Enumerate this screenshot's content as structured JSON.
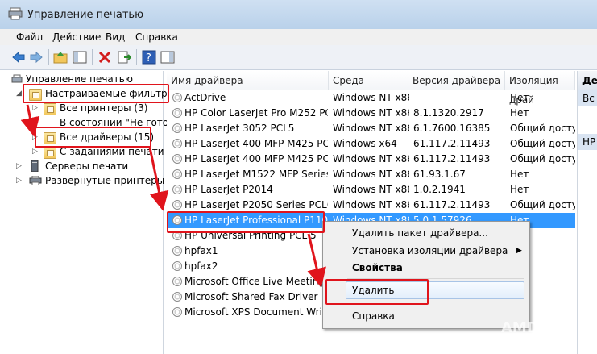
{
  "window": {
    "title": "Управление печатью"
  },
  "menu": [
    "Файл",
    "Действие",
    "Вид",
    "Справка"
  ],
  "tree": {
    "root": "Управление печатью",
    "custom_filters": "Настраиваемые фильтры",
    "all_printers": "Все принтеры (3)",
    "not_ready": "В состоянии \"Не готов",
    "all_drivers": "Все драйверы (15)",
    "print_jobs": "С заданиями печати",
    "print_servers": "Серверы печати",
    "deployed": "Развернутые принтеры"
  },
  "columns": [
    "Имя драйвера",
    "Среда",
    "Версия драйвера",
    "Изоляция драй"
  ],
  "rows": [
    {
      "name": "ActDrive",
      "env": "Windows NT x86",
      "ver": "",
      "iso": "Нет"
    },
    {
      "name": "HP Color LaserJet Pro M252 PC...",
      "env": "Windows NT x86",
      "ver": "8.1.1320.2917",
      "iso": "Нет"
    },
    {
      "name": "HP LaserJet 3052 PCL5",
      "env": "Windows NT x86",
      "ver": "6.1.7600.16385",
      "iso": "Общий доступ"
    },
    {
      "name": "HP LaserJet 400 MFP M425 PCL 6",
      "env": "Windows x64",
      "ver": "61.117.2.11493",
      "iso": "Общий доступ"
    },
    {
      "name": "HP LaserJet 400 MFP M425 PCL 6",
      "env": "Windows NT x86",
      "ver": "61.117.2.11493",
      "iso": "Общий доступ"
    },
    {
      "name": "HP LaserJet M1522 MFP Series ...",
      "env": "Windows NT x86",
      "ver": "61.93.1.67",
      "iso": "Нет"
    },
    {
      "name": "HP LaserJet P2014",
      "env": "Windows NT x86",
      "ver": "1.0.2.1941",
      "iso": "Нет"
    },
    {
      "name": "HP LaserJet P2050 Series PCL6",
      "env": "Windows NT x86",
      "ver": "61.117.2.11493",
      "iso": "Общий доступ"
    },
    {
      "name": "HP LaserJet Professional P1102",
      "env": "Windows NT x86",
      "ver": "5.0.1.57926",
      "iso": "Нет"
    },
    {
      "name": "HP Universal Printing PCL 5",
      "env": "",
      "ver": "",
      "iso": ""
    },
    {
      "name": "hpfax1",
      "env": "",
      "ver": "",
      "iso": ""
    },
    {
      "name": "hpfax2",
      "env": "",
      "ver": "",
      "iso": ""
    },
    {
      "name": "Microsoft Office Live Meeting 2...",
      "env": "",
      "ver": "",
      "iso": ""
    },
    {
      "name": "Microsoft Shared Fax Driver",
      "env": "",
      "ver": "",
      "iso": ""
    },
    {
      "name": "Microsoft XPS Document Writer",
      "env": "",
      "ver": "",
      "iso": ""
    }
  ],
  "selected_row": 8,
  "actions_pane": {
    "header": "Де",
    "item1": "Вс",
    "item2": "HP"
  },
  "context_menu": {
    "remove_package": "Удалить пакет драйвера...",
    "isolation": "Установка изоляции драйвера",
    "properties": "Свойства",
    "delete": "Удалить",
    "help": "Справка"
  },
  "watermark": "AMD"
}
